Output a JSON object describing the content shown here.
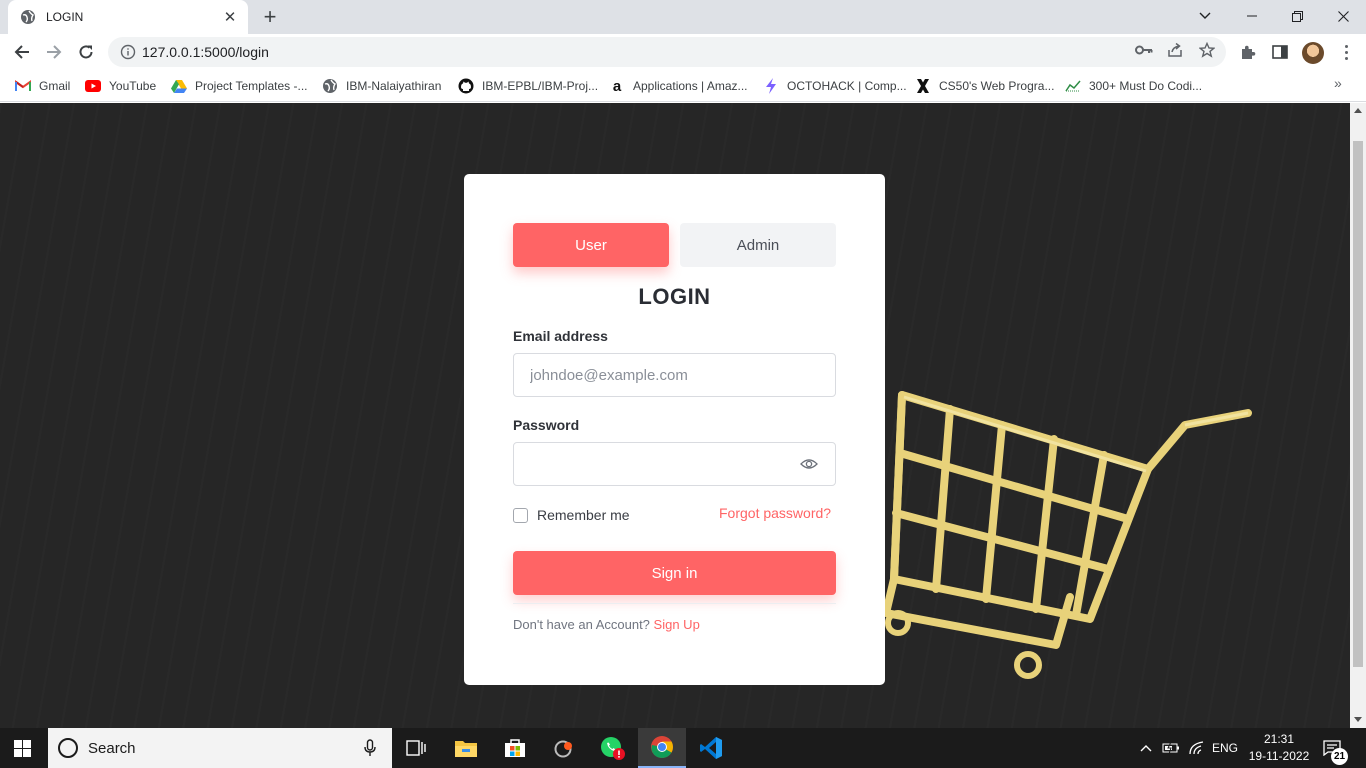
{
  "browser": {
    "tab_title": "LOGIN",
    "url": "127.0.0.1:5000/login",
    "bookmarks": [
      {
        "label": "Gmail",
        "icon": "gmail-icon"
      },
      {
        "label": "YouTube",
        "icon": "youtube-icon"
      },
      {
        "label": "Project Templates -...",
        "icon": "google-drive-icon"
      },
      {
        "label": "IBM-Nalaiyathiran",
        "icon": "globe-icon"
      },
      {
        "label": "IBM-EPBL/IBM-Proj...",
        "icon": "github-icon"
      },
      {
        "label": "Applications | Amaz...",
        "icon": "amazon-icon"
      },
      {
        "label": "OCTOHACK | Comp...",
        "icon": "octohack-icon"
      },
      {
        "label": "CS50's Web Progra...",
        "icon": "edx-icon"
      },
      {
        "label": "300+ Must Do Codi...",
        "icon": "chart-icon"
      }
    ],
    "bookmarks_more": "»"
  },
  "login": {
    "role_user": "User",
    "role_admin": "Admin",
    "title": "LOGIN",
    "email_label": "Email address",
    "email_placeholder": "johndoe@example.com",
    "password_label": "Password",
    "remember_label": "Remember me",
    "forgot_label": "Forgot password?",
    "signin_label": "Sign in",
    "signup_prompt": "Don't have an Account?",
    "signup_link": "Sign Up"
  },
  "taskbar": {
    "search_text": "Search",
    "language": "ENG",
    "time": "21:31",
    "date": "19-11-2022",
    "notification_count": "21"
  },
  "colors": {
    "accent": "#ff6465",
    "page_background": "#262626",
    "cart": "#e8d27a"
  }
}
